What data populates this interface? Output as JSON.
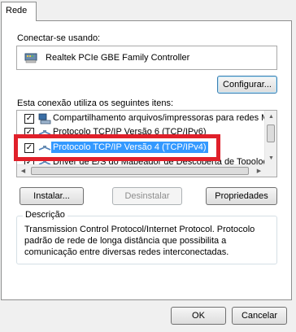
{
  "tabs": [
    {
      "label": "Rede"
    }
  ],
  "connect": {
    "label": "Conectar-se usando:",
    "adapter": "Realtek PCIe GBE Family Controller",
    "configure_button": "Configurar..."
  },
  "items": {
    "label": "Esta conexão utiliza os seguintes itens:",
    "rows": [
      {
        "checked": true,
        "text": "Compartilhamento arquivos/impressoras para redes Mic",
        "icon": "network-service-icon"
      },
      {
        "checked": true,
        "text": "Protocolo TCP/IP Versão 6 (TCP/IPv6)",
        "icon": "protocol-icon"
      },
      {
        "checked": true,
        "text": "Protocolo TCP/IP Versão 4 (TCP/IPv4)",
        "icon": "protocol-icon",
        "selected": true
      },
      {
        "checked": true,
        "text": "Driver de E/S do Mapeador de Descoberta de Topologi",
        "icon": "protocol-icon"
      }
    ]
  },
  "buttons": {
    "install": "Instalar...",
    "uninstall": "Desinstalar",
    "properties": "Propriedades"
  },
  "description": {
    "title": "Descrição",
    "text": "Transmission Control Protocol/Internet Protocol. Protocolo padrão de rede de longa distância que possibilita a comunicação entre diversas redes interconectadas."
  },
  "footer": {
    "ok": "OK",
    "cancel": "Cancelar"
  },
  "colors": {
    "selection": "#3399ff",
    "highlight_frame": "#e0202a"
  }
}
